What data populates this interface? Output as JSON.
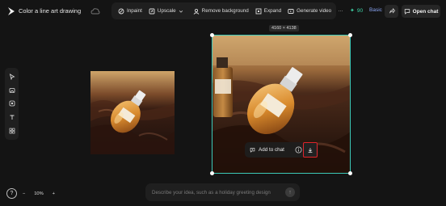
{
  "header": {
    "project_title": "Color a line art drawing",
    "credits": "90",
    "plan": "Basic",
    "open_chat_label": "Open chat"
  },
  "toolbar": {
    "inpaint": "Inpaint",
    "upscale": "Upscale",
    "remove_background": "Remove background",
    "expand": "Expand",
    "generate_video": "Generate video",
    "more": "···"
  },
  "canvas": {
    "selected_dimensions": "4160 × 4138",
    "add_to_chat_label": "Add to chat"
  },
  "prompt": {
    "placeholder": "Describe your idea, such as a holiday greeting design"
  },
  "zoom": {
    "minus": "−",
    "level": "10%",
    "plus": "+"
  },
  "help_label": "?",
  "colors": {
    "background": "#141414",
    "selection": "#3cc9b8",
    "credits": "#3ed4a8",
    "highlight_box": "#e0242a"
  }
}
